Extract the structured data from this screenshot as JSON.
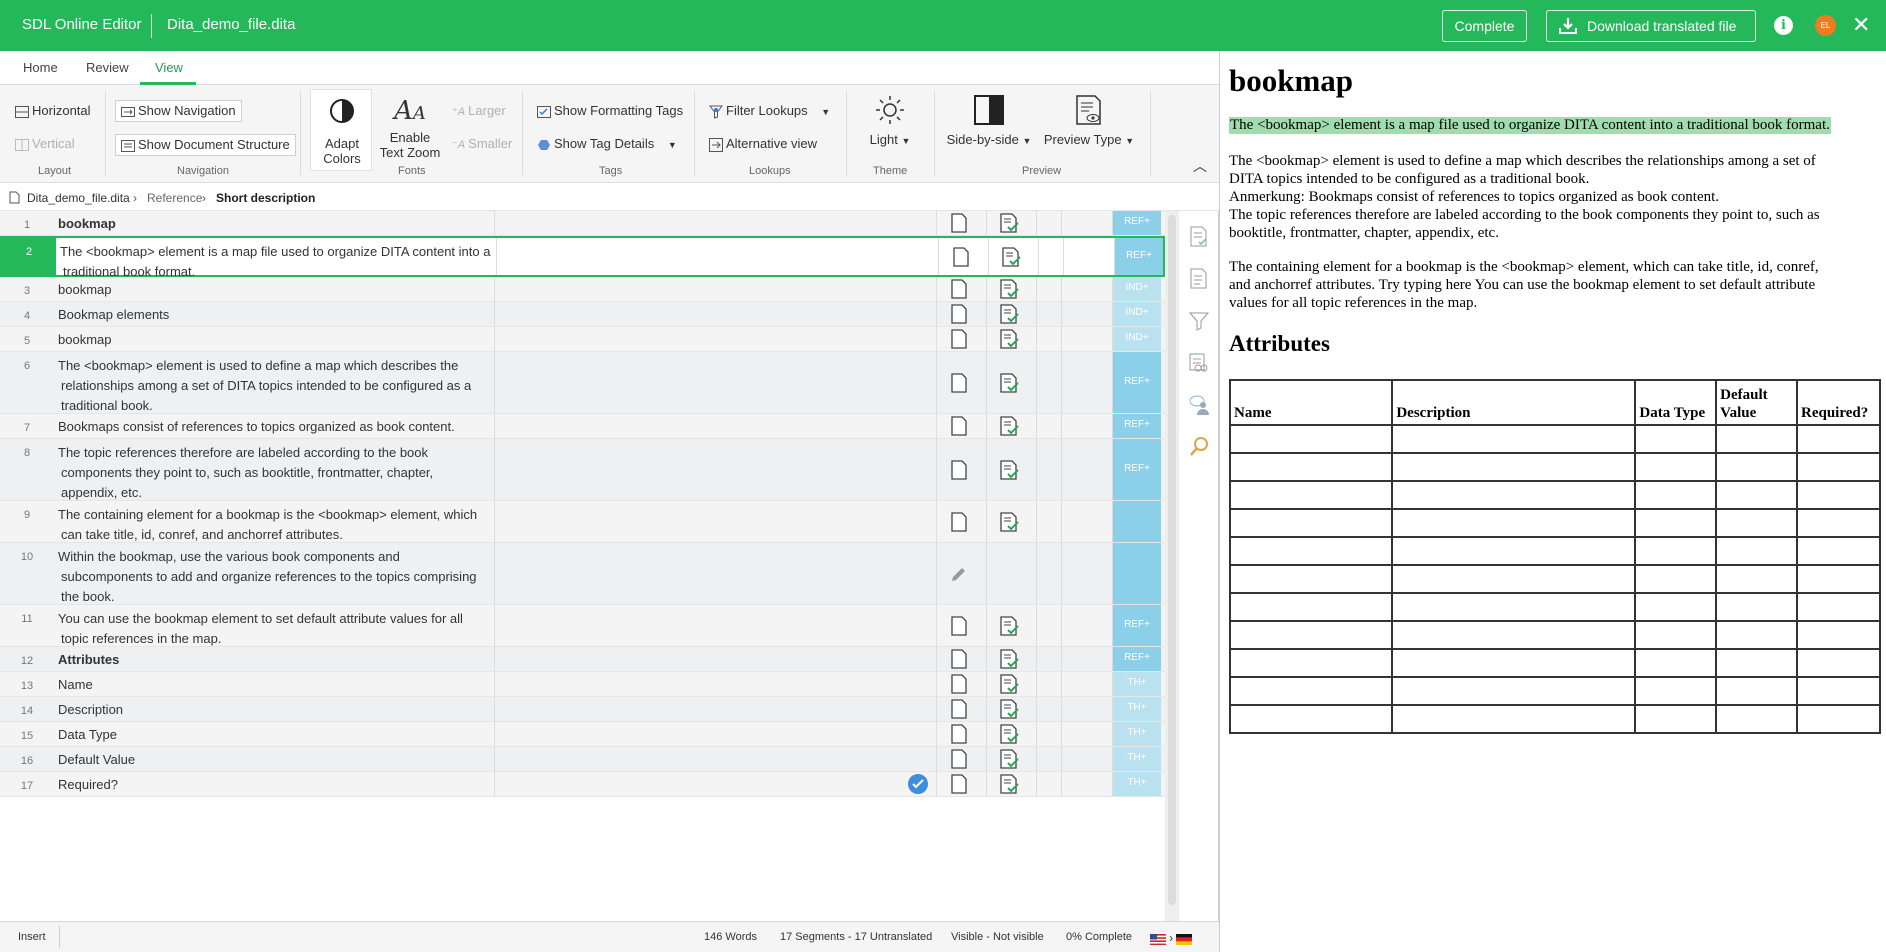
{
  "topbar": {
    "app_name": "SDL Online Editor",
    "file_name": "Dita_demo_file.dita",
    "complete_label": "Complete",
    "download_label": "Download translated file",
    "avatar_initials": "EL"
  },
  "tabs": [
    "Home",
    "Review",
    "View"
  ],
  "active_tab": "View",
  "ribbon": {
    "layout": {
      "horizontal": "Horizontal",
      "vertical": "Vertical",
      "label": "Layout"
    },
    "navigation": {
      "show_navigation": "Show Navigation",
      "show_document_structure": "Show Document Structure",
      "label": "Navigation"
    },
    "fonts": {
      "adapt_1": "Adapt",
      "adapt_2": "Colors",
      "zoom_1": "Enable",
      "zoom_2": "Text Zoom",
      "larger": "Larger",
      "smaller": "Smaller",
      "label": "Fonts"
    },
    "tags": {
      "show_formatting_tags": "Show Formatting Tags",
      "show_tag_details": "Show Tag Details",
      "label": "Tags"
    },
    "lookups": {
      "filter_lookups": "Filter Lookups",
      "alternative_view": "Alternative view",
      "label": "Lookups"
    },
    "theme": {
      "value": "Light",
      "label": "Theme"
    },
    "preview": {
      "side_by_side": "Side-by-side",
      "preview_type": "Preview Type",
      "label": "Preview"
    }
  },
  "breadcrumb": [
    "Dita_demo_file.dita",
    "Reference",
    "Short description"
  ],
  "segments": [
    {
      "num": "1",
      "lines": [
        "bookmap"
      ],
      "bold": true,
      "tag": "REF+"
    },
    {
      "num": "2",
      "lines": [
        "The <bookmap> element is a map file used to organize DITA content into a",
        "traditional book format."
      ],
      "tag": "REF+"
    },
    {
      "num": "3",
      "lines": [
        "bookmap"
      ],
      "tag": "IND+"
    },
    {
      "num": "4",
      "lines": [
        "Bookmap elements"
      ],
      "tag": "IND+"
    },
    {
      "num": "5",
      "lines": [
        "bookmap"
      ],
      "tag": "IND+"
    },
    {
      "num": "6",
      "lines": [
        "The <bookmap> element is used to define a map which describes the",
        "relationships among a set of DITA topics intended to be configured as a",
        "traditional book."
      ],
      "tag": "REF+"
    },
    {
      "num": "7",
      "lines": [
        "Bookmaps consist of references to topics organized as book content."
      ],
      "tag": "REF+"
    },
    {
      "num": "8",
      "lines": [
        "The topic references therefore are labeled according to the book",
        "components they point to, such as booktitle, frontmatter, chapter,",
        "appendix, etc."
      ],
      "tag": "REF+"
    },
    {
      "num": "9",
      "lines": [
        "The containing element for a bookmap is the <bookmap> element, which",
        "can take title, id, conref, and anchorref attributes."
      ],
      "tag": ""
    },
    {
      "num": "10",
      "lines": [
        "Within the bookmap, use the various book components and",
        "subcomponents to add and organize references to the topics comprising",
        "the book."
      ],
      "tag": ""
    },
    {
      "num": "11",
      "lines": [
        "You can use the bookmap element to set default attribute values for all",
        "topic references in the map."
      ],
      "tag": "REF+"
    },
    {
      "num": "12",
      "lines": [
        "Attributes"
      ],
      "bold": true,
      "tag": "REF+"
    },
    {
      "num": "13",
      "lines": [
        "Name"
      ],
      "tag": "TH+"
    },
    {
      "num": "14",
      "lines": [
        "Description"
      ],
      "tag": "TH+"
    },
    {
      "num": "15",
      "lines": [
        "Data Type"
      ],
      "tag": "TH+"
    },
    {
      "num": "16",
      "lines": [
        "Default Value"
      ],
      "tag": "TH+"
    },
    {
      "num": "17",
      "lines": [
        "Required?"
      ],
      "tag": "TH+"
    }
  ],
  "status": {
    "mode": "Insert",
    "words": "146 Words",
    "segments": "17 Segments - 17 Untranslated",
    "visible": "Visible - Not visible",
    "complete": "0% Complete"
  },
  "preview": {
    "title": "bookmap",
    "highlight": "The <bookmap> element is a map file used to organize DITA content into a traditional book format.",
    "para1": [
      "The <bookmap> element is used to define a map which describes the relationships among a set of",
      "DITA topics intended to be configured as a traditional book.",
      "Anmerkung: Bookmaps consist of references to topics organized as book content.",
      "The topic references therefore are labeled according to the book components they point to, such as",
      "booktitle, frontmatter, chapter, appendix, etc."
    ],
    "para2": [
      "The containing element for a bookmap is the <bookmap> element, which can take title, id, conref,",
      "and anchorref attributes. Try typing here You can use the bookmap element to set default attribute",
      "values for all topic references in the map."
    ],
    "attributes_heading": "Attributes",
    "table_headers": [
      "Name",
      "Description",
      "Data Type",
      "Default Value",
      "Required?"
    ]
  },
  "colors": {
    "brand_green": "#25b85a",
    "tag_blue": "#8ccfe8",
    "highlight": "#9fdcae"
  }
}
